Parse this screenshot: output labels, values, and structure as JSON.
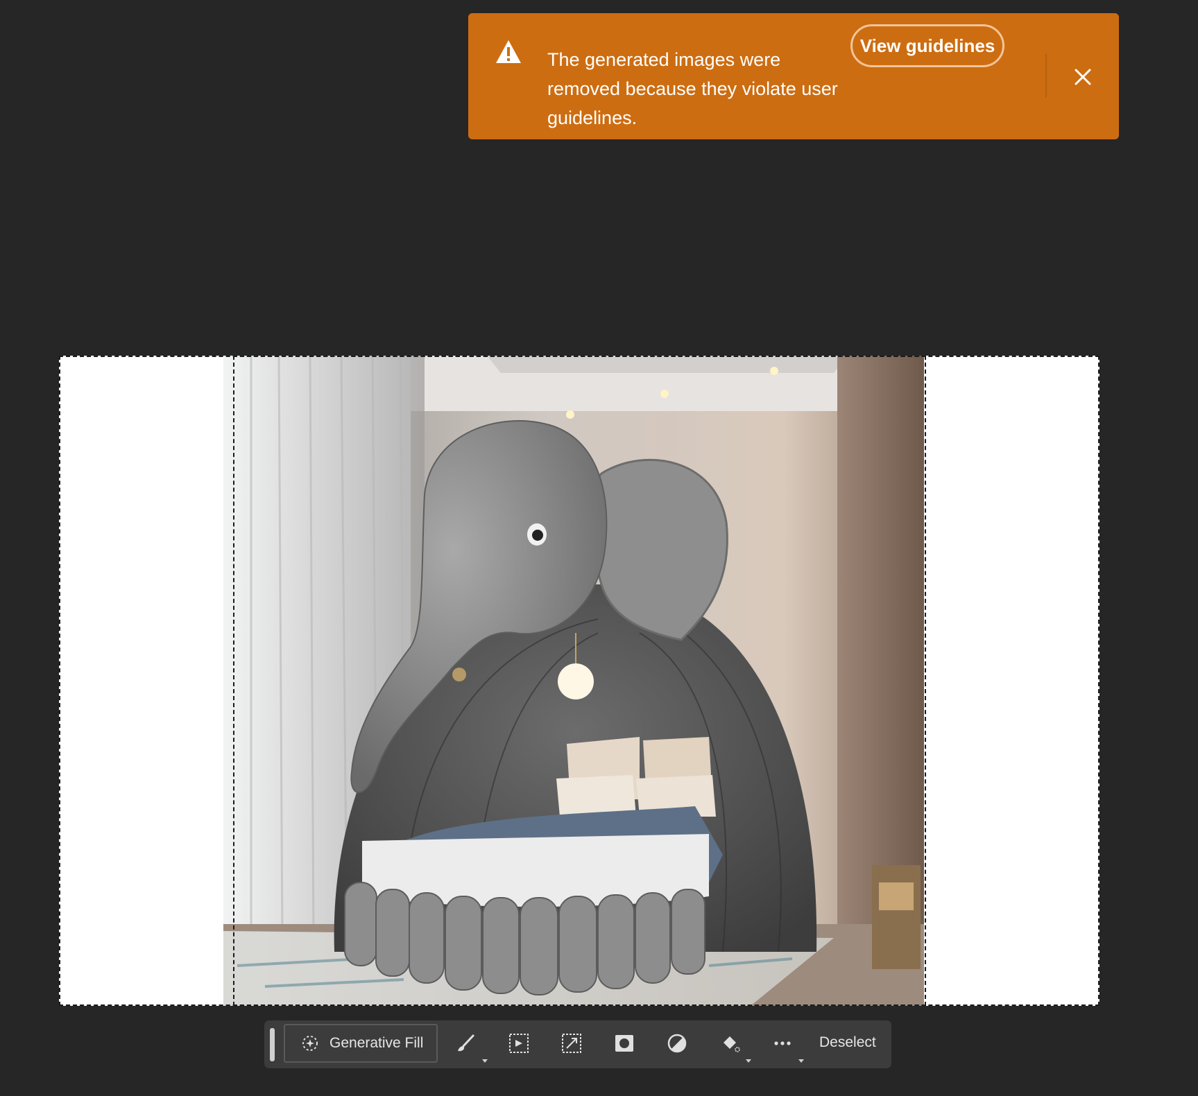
{
  "toast": {
    "message": "The generated images were removed because they violate user guidelines.",
    "button_label": "View guidelines",
    "background_color": "#cd6d11",
    "icon": "warning-icon",
    "close_icon": "close-icon"
  },
  "canvas": {
    "image_subject": "elephant-shaped canopy bed in a bedroom",
    "background_color": "#ffffff",
    "selection": "marquee-selection"
  },
  "taskbar": {
    "primary_label": "Generative Fill",
    "deselect_label": "Deselect",
    "tools": [
      "brush-icon",
      "select-subject-icon",
      "transform-selection-icon",
      "mask-icon",
      "invert-icon",
      "fill-icon",
      "more-icon"
    ]
  }
}
